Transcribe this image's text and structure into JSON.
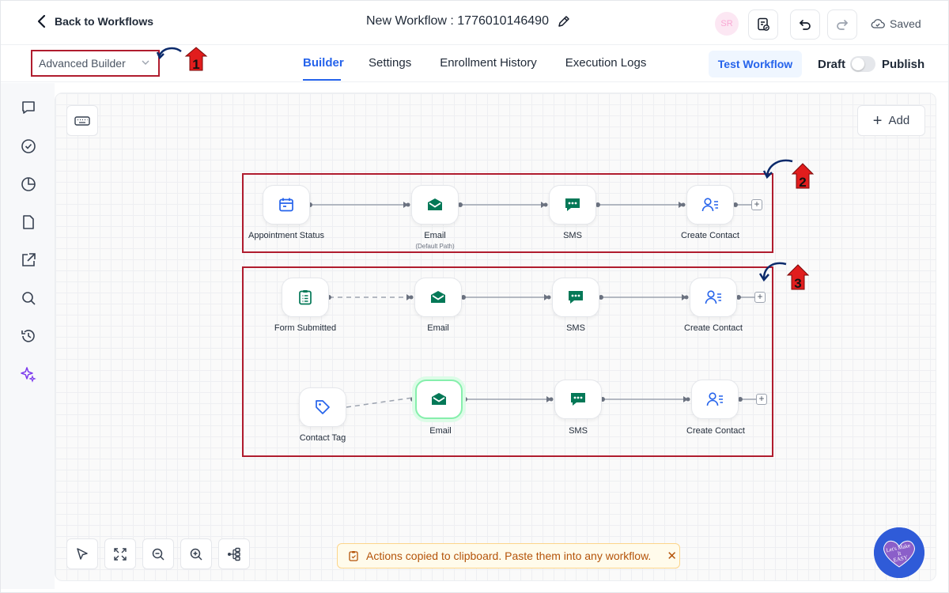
{
  "header": {
    "back_label": "Back to Workflows",
    "workflow_title": "New Workflow : 1776010146490",
    "avatar_initials": "SR",
    "saved_label": "Saved"
  },
  "subbar": {
    "builder_select_value": "Advanced Builder",
    "tabs": [
      {
        "label": "Builder",
        "active": true
      },
      {
        "label": "Settings",
        "active": false
      },
      {
        "label": "Enrollment History",
        "active": false
      },
      {
        "label": "Execution Logs",
        "active": false
      }
    ],
    "test_workflow_label": "Test Workflow",
    "draft_label": "Draft",
    "publish_label": "Publish",
    "publish_toggle_on": false
  },
  "rail_icons": [
    "chat-icon",
    "check-circle-icon",
    "pie-chart-icon",
    "document-icon",
    "external-link-icon",
    "search-icon",
    "history-icon",
    "sparkles-icon"
  ],
  "canvas": {
    "add_label": "Add",
    "annotations": [
      "1",
      "2",
      "3"
    ],
    "flow_1": {
      "trigger": "Appointment Status",
      "actions": [
        "Email",
        "SMS",
        "Create Contact"
      ],
      "email_sub_label": "(Default Path)"
    },
    "flow_2": {
      "trigger": "Form Submitted",
      "actions": [
        "Email",
        "SMS",
        "Create Contact"
      ]
    },
    "flow_3": {
      "trigger": "Contact Tag",
      "actions": [
        "Email",
        "SMS",
        "Create Contact"
      ]
    },
    "toast": "Actions copied to clipboard. Paste them into any workflow.",
    "logo_text": "Let's Make It EASY"
  },
  "colors": {
    "accent": "#2563eb",
    "annotation_red": "#b01c2e",
    "arrow_navy": "#0b2a6b",
    "action_green": "#047857",
    "toast_text": "#b45309"
  }
}
